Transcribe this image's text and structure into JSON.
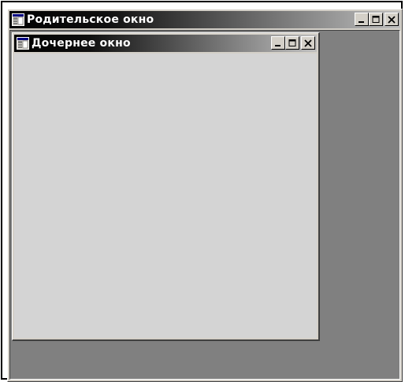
{
  "parent_window": {
    "title": "Родительское окно",
    "icon": "form-icon",
    "buttons": [
      "minimize",
      "maximize",
      "close"
    ]
  },
  "child_window": {
    "title": "Дочернее окно",
    "icon": "form-icon",
    "buttons": [
      "minimize",
      "maximize",
      "close"
    ]
  },
  "colors": {
    "title_gradient_start": "#000000",
    "title_gradient_end": "#bfbfbf",
    "mdi_background": "#808080",
    "window_face": "#d4d0c8"
  }
}
